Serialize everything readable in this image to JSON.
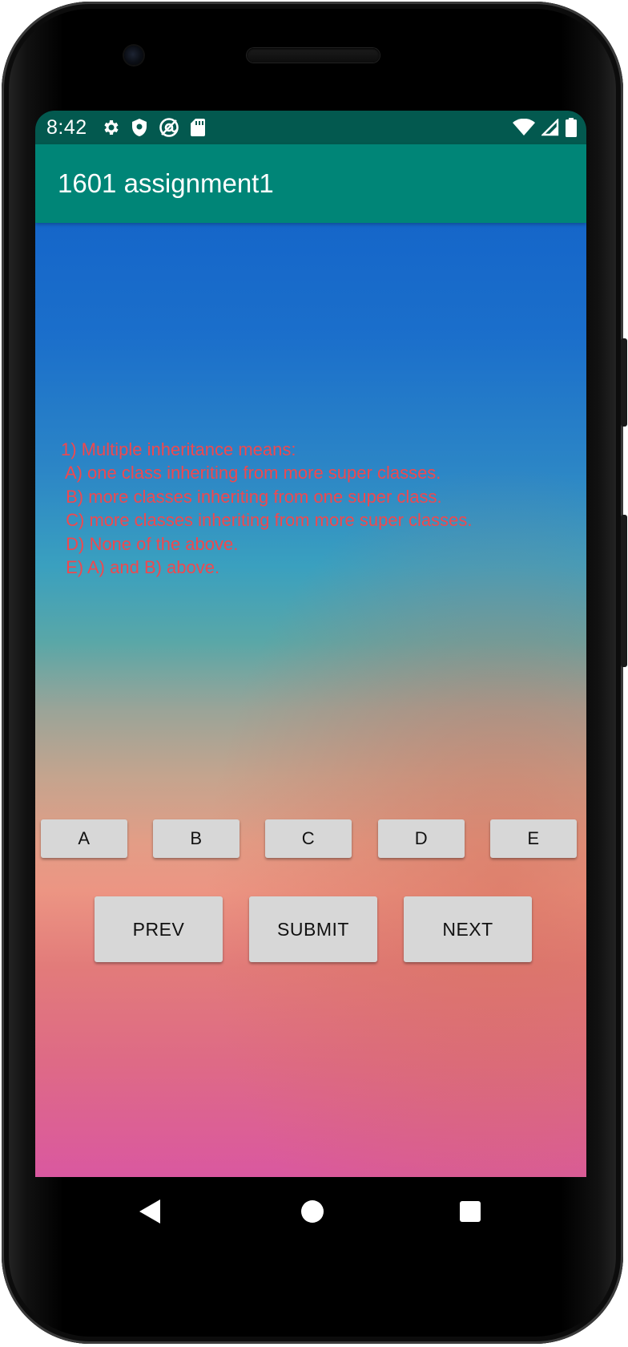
{
  "status_bar": {
    "time": "8:42",
    "left_icons": [
      "settings-icon",
      "shield-icon",
      "at-sign-icon",
      "sd-card-icon"
    ],
    "right_icons": [
      "wifi-icon",
      "signal-icon",
      "battery-icon"
    ],
    "background": "#03594f"
  },
  "app_bar": {
    "title": "1601 assignment1",
    "background": "#008577"
  },
  "question": {
    "text": "1) Multiple inheritance means:\n A) one class inheriting from more super classes.\n B) more classes inheriting from one super class.\n C) more classes inheriting from more super classes.\n D) None of the above.\n E) A) and B) above.",
    "color": "#f0484e"
  },
  "answer_buttons": [
    {
      "label": "A"
    },
    {
      "label": "B"
    },
    {
      "label": "C"
    },
    {
      "label": "D"
    },
    {
      "label": "E"
    }
  ],
  "nav_buttons": {
    "prev": "PREV",
    "submit": "SUBMIT",
    "next": "NEXT"
  },
  "system_nav": [
    "back-icon",
    "home-icon",
    "recents-icon"
  ]
}
